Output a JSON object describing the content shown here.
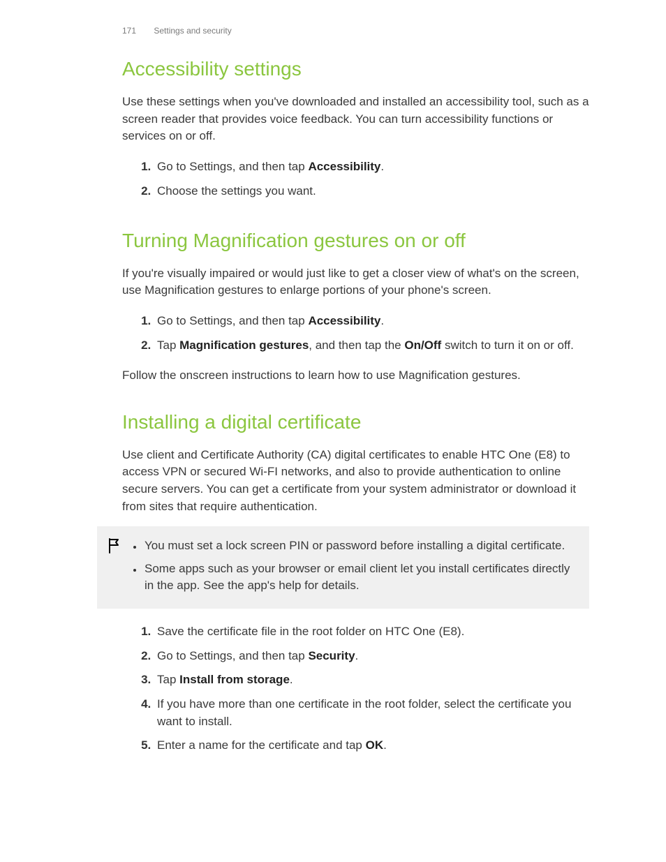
{
  "header": {
    "page_number": "171",
    "section_title": "Settings and security"
  },
  "sections": {
    "s1": {
      "title": "Accessibility settings",
      "intro": "Use these settings when you've downloaded and installed an accessibility tool, such as a screen reader that provides voice feedback. You can turn accessibility functions or services on or off.",
      "steps": {
        "1_pre": "Go to Settings, and then tap ",
        "1_bold": "Accessibility",
        "1_post": ".",
        "2": "Choose the settings you want."
      }
    },
    "s2": {
      "title": "Turning Magnification gestures on or off",
      "intro": "If you're visually impaired or would just like to get a closer view of what's on the screen, use Magnification gestures to enlarge portions of your phone's screen.",
      "steps": {
        "1_pre": "Go to Settings, and then tap ",
        "1_bold": "Accessibility",
        "1_post": ".",
        "2_pre": "Tap ",
        "2_bold1": "Magnification gestures",
        "2_mid": ", and then tap the ",
        "2_bold2": "On/Off",
        "2_post": " switch to turn it on or off."
      },
      "outro": "Follow the onscreen instructions to learn how to use Magnification gestures."
    },
    "s3": {
      "title": "Installing a digital certificate",
      "intro": "Use client and Certificate Authority (CA) digital certificates to enable HTC One (E8) to access VPN or secured Wi-FI networks, and also to provide authentication to online secure servers. You can get a certificate from your system administrator or download it from sites that require authentication.",
      "notes": {
        "1": "You must set a lock screen PIN or password before installing a digital certificate.",
        "2": "Some apps such as your browser or email client let you install certificates directly in the app. See the app's help for details."
      },
      "steps": {
        "1": "Save the certificate file in the root folder on HTC One (E8).",
        "2_pre": "Go to Settings, and then tap ",
        "2_bold": "Security",
        "2_post": ".",
        "3_pre": "Tap ",
        "3_bold": "Install from storage",
        "3_post": ".",
        "4": "If you have more than one certificate in the root folder, select the certificate you want to install.",
        "5_pre": "Enter a name for the certificate and tap ",
        "5_bold": "OK",
        "5_post": "."
      }
    }
  }
}
